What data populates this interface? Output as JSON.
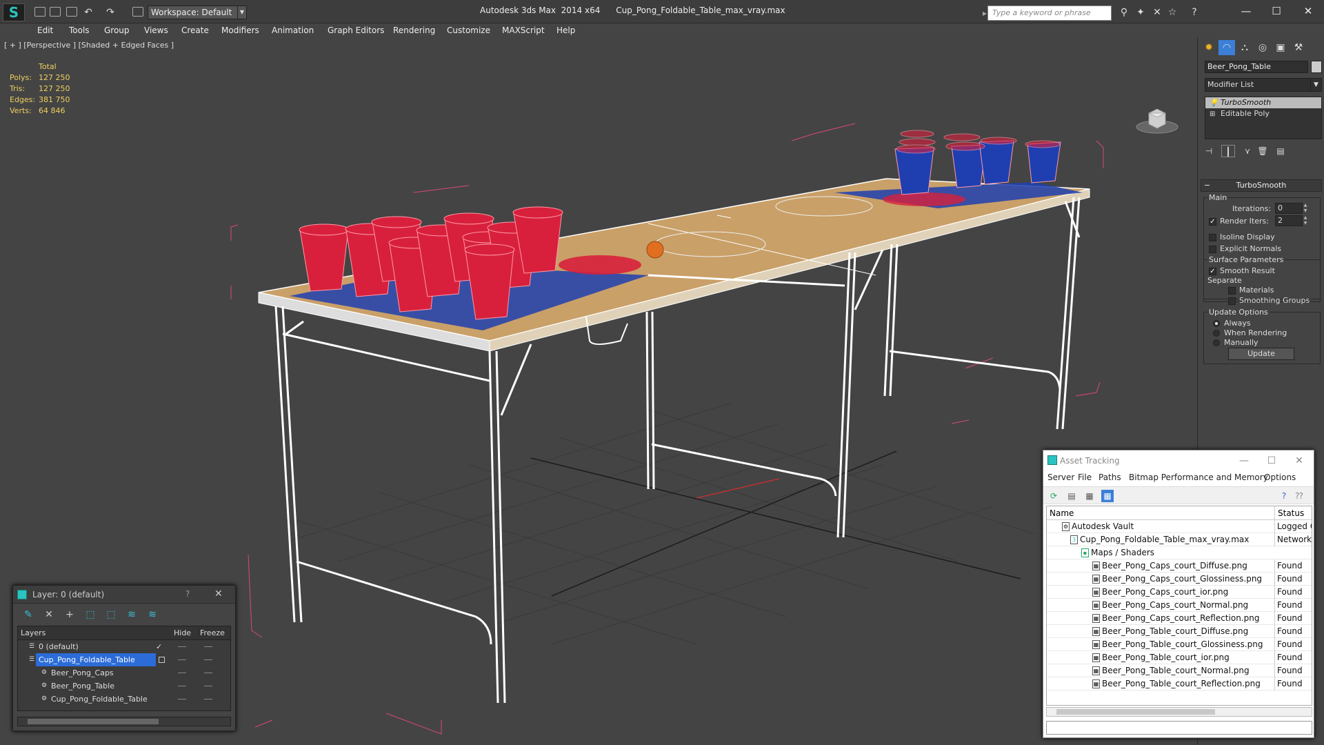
{
  "titlebar": {
    "app_title": "Autodesk 3ds Max  2014 x64      Cup_Pong_Foldable_Table_max_vray.max",
    "workspace": "Workspace: Default",
    "search_placeholder": "Type a keyword or phrase"
  },
  "menubar": {
    "items": [
      "Edit",
      "Tools",
      "Group",
      "Views",
      "Create",
      "Modifiers",
      "Animation",
      "Graph Editors",
      "Rendering",
      "Customize",
      "MAXScript",
      "Help"
    ]
  },
  "viewport": {
    "label": "[ + ] [Perspective ] [Shaded + Edged Faces ]",
    "stats": {
      "header": "Total",
      "rows": [
        {
          "label": "Polys:",
          "value": "127 250"
        },
        {
          "label": "Tris:",
          "value": "127 250"
        },
        {
          "label": "Edges:",
          "value": "381 750"
        },
        {
          "label": "Verts:",
          "value": "64 846"
        }
      ]
    }
  },
  "command_panel": {
    "object_name": "Beer_Pong_Table",
    "modifier_list": "Modifier List",
    "stack": [
      "TurboSmooth",
      "Editable Poly"
    ],
    "rollout_title": "TurboSmooth",
    "main_group": "Main",
    "iterations_label": "Iterations:",
    "iterations_value": "0",
    "render_iters_label": "Render Iters:",
    "render_iters_value": "2",
    "render_iters_checked": true,
    "isoline_label": "Isoline Display",
    "explicit_normals_label": "Explicit Normals",
    "surface_group": "Surface Parameters",
    "smooth_result_label": "Smooth Result",
    "separate_label": "Separate",
    "materials_label": "Materials",
    "smoothing_groups_label": "Smoothing Groups",
    "update_group": "Update Options",
    "update_options": [
      "Always",
      "When Rendering",
      "Manually"
    ],
    "update_selected": "Always",
    "update_button": "Update"
  },
  "layer_dialog": {
    "title": "Layer: 0 (default)",
    "help": "?",
    "columns": {
      "layers": "Layers",
      "hide": "Hide",
      "freeze": "Freeze"
    },
    "rows": [
      {
        "name": "0 (default)",
        "indent": 0,
        "selected": false
      },
      {
        "name": "Cup_Pong_Foldable_Table",
        "indent": 0,
        "selected": true
      },
      {
        "name": "Beer_Pong_Caps",
        "indent": 1,
        "selected": false
      },
      {
        "name": "Beer_Pong_Table",
        "indent": 1,
        "selected": false
      },
      {
        "name": "Cup_Pong_Foldable_Table",
        "indent": 1,
        "selected": false
      }
    ]
  },
  "asset_tracking": {
    "title": "Asset Tracking",
    "menu": [
      "Server",
      "File",
      "Paths",
      "Bitmap Performance and Memory",
      "Options"
    ],
    "columns": {
      "name": "Name",
      "status": "Status"
    },
    "rows": [
      {
        "name": "Autodesk Vault",
        "status": "Logged O",
        "indent": 0
      },
      {
        "name": "Cup_Pong_Foldable_Table_max_vray.max",
        "status": "Network I",
        "indent": 1
      },
      {
        "name": "Maps / Shaders",
        "status": "",
        "indent": 2
      },
      {
        "name": "Beer_Pong_Caps_court_Diffuse.png",
        "status": "Found",
        "indent": 3
      },
      {
        "name": "Beer_Pong_Caps_court_Glossiness.png",
        "status": "Found",
        "indent": 3
      },
      {
        "name": "Beer_Pong_Caps_court_ior.png",
        "status": "Found",
        "indent": 3
      },
      {
        "name": "Beer_Pong_Caps_court_Normal.png",
        "status": "Found",
        "indent": 3
      },
      {
        "name": "Beer_Pong_Caps_court_Reflection.png",
        "status": "Found",
        "indent": 3
      },
      {
        "name": "Beer_Pong_Table_court_Diffuse.png",
        "status": "Found",
        "indent": 3
      },
      {
        "name": "Beer_Pong_Table_court_Glossiness.png",
        "status": "Found",
        "indent": 3
      },
      {
        "name": "Beer_Pong_Table_court_ior.png",
        "status": "Found",
        "indent": 3
      },
      {
        "name": "Beer_Pong_Table_court_Normal.png",
        "status": "Found",
        "indent": 3
      },
      {
        "name": "Beer_Pong_Table_court_Reflection.png",
        "status": "Found",
        "indent": 3
      }
    ]
  },
  "colors": {
    "viewport_bg": "#444444",
    "stats_text": "#f0d060",
    "selection_blue": "#2b6cd8",
    "cup_red": "#d8203c",
    "table_wood": "#c9a068",
    "court_blue": "#1f3fb0",
    "bbox_pink": "#d84a78"
  }
}
